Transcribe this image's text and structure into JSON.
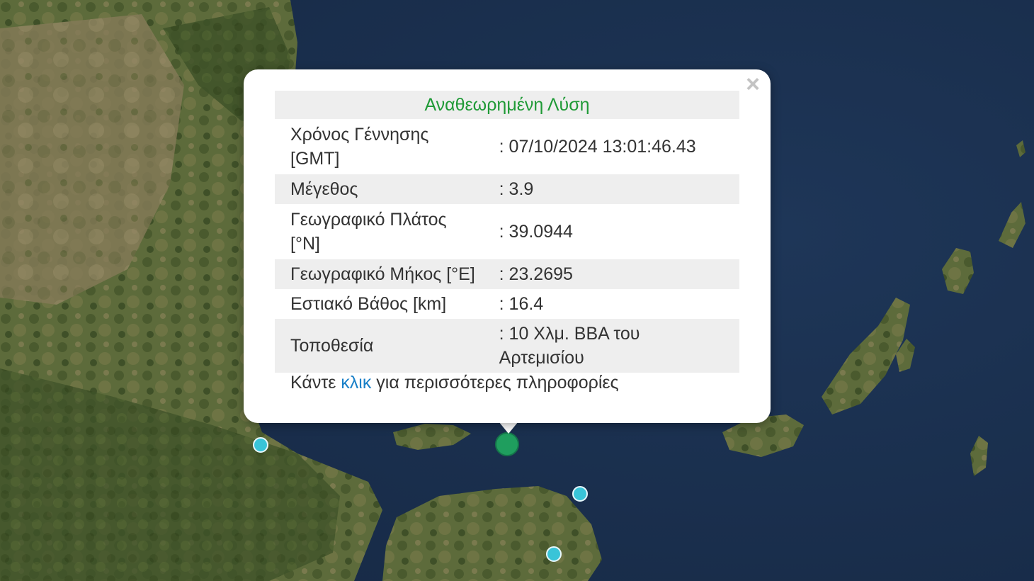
{
  "map": {
    "sea_color": "#1a2f4f",
    "land_color": "#5b6a3a",
    "markers": [
      {
        "kind": "main",
        "color": "#1f9e5e"
      },
      {
        "kind": "small",
        "color": "#39c4d8"
      },
      {
        "kind": "small",
        "color": "#39c4d8"
      },
      {
        "kind": "small",
        "color": "#39c4d8"
      }
    ]
  },
  "popup": {
    "close_icon": "×",
    "title": "Αναθεωρημένη Λύση",
    "title_color": "#1f9a36",
    "rows": [
      {
        "label": "Χρόνος Γέννησης [GMT]",
        "value": ": 07/10/2024 13:01:46.43"
      },
      {
        "label": "Μέγεθος",
        "value": ": 3.9"
      },
      {
        "label": "Γεωγραφικό Πλάτος [°N]",
        "value": ": 39.0944"
      },
      {
        "label": "Γεωγραφικό Μήκος [°E]",
        "value": ": 23.2695"
      },
      {
        "label": "Εστιακό Βάθος [km]",
        "value": ": 16.4"
      },
      {
        "label": "Τοποθεσία",
        "value": ": 10 Χλμ. ΒΒΑ του Αρτεμισίου"
      }
    ],
    "footer": {
      "before": "Κάντε ",
      "link": "κλικ",
      "after": " για περισσότερες πληροφορίες",
      "link_color": "#1a80c8"
    }
  }
}
